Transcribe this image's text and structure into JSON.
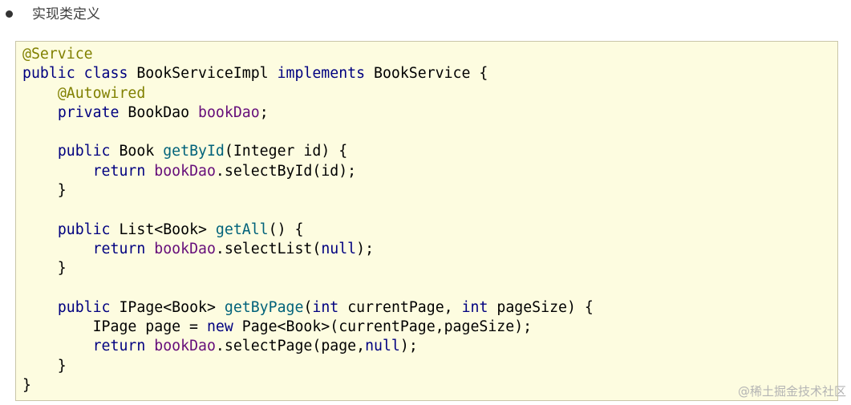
{
  "bullet": {
    "text": "实现类定义"
  },
  "code_block": {
    "language": "java",
    "lines": [
      [
        {
          "t": "@Service",
          "k": "anno"
        }
      ],
      [
        {
          "t": "public",
          "k": "kw"
        },
        {
          "t": " ",
          "k": "plain"
        },
        {
          "t": "class",
          "k": "kw"
        },
        {
          "t": " BookServiceImpl ",
          "k": "plain"
        },
        {
          "t": "implements",
          "k": "kw"
        },
        {
          "t": " BookService {",
          "k": "plain"
        }
      ],
      [
        {
          "t": "    ",
          "k": "plain"
        },
        {
          "t": "@Autowired",
          "k": "anno"
        }
      ],
      [
        {
          "t": "    ",
          "k": "plain"
        },
        {
          "t": "private",
          "k": "kw"
        },
        {
          "t": " BookDao ",
          "k": "plain"
        },
        {
          "t": "bookDao",
          "k": "field"
        },
        {
          "t": ";",
          "k": "plain"
        }
      ],
      [],
      [
        {
          "t": "    ",
          "k": "plain"
        },
        {
          "t": "public",
          "k": "kw"
        },
        {
          "t": " Book ",
          "k": "plain"
        },
        {
          "t": "getById",
          "k": "method"
        },
        {
          "t": "(Integer id) {",
          "k": "plain"
        }
      ],
      [
        {
          "t": "        ",
          "k": "plain"
        },
        {
          "t": "return",
          "k": "kw"
        },
        {
          "t": " ",
          "k": "plain"
        },
        {
          "t": "bookDao",
          "k": "field"
        },
        {
          "t": ".selectById(id);",
          "k": "plain"
        }
      ],
      [
        {
          "t": "    }",
          "k": "plain"
        }
      ],
      [],
      [
        {
          "t": "    ",
          "k": "plain"
        },
        {
          "t": "public",
          "k": "kw"
        },
        {
          "t": " List<Book> ",
          "k": "plain"
        },
        {
          "t": "getAll",
          "k": "method"
        },
        {
          "t": "() {",
          "k": "plain"
        }
      ],
      [
        {
          "t": "        ",
          "k": "plain"
        },
        {
          "t": "return",
          "k": "kw"
        },
        {
          "t": " ",
          "k": "plain"
        },
        {
          "t": "bookDao",
          "k": "field"
        },
        {
          "t": ".selectList(",
          "k": "plain"
        },
        {
          "t": "null",
          "k": "kw"
        },
        {
          "t": ");",
          "k": "plain"
        }
      ],
      [
        {
          "t": "    }",
          "k": "plain"
        }
      ],
      [],
      [
        {
          "t": "    ",
          "k": "plain"
        },
        {
          "t": "public",
          "k": "kw"
        },
        {
          "t": " IPage<Book> ",
          "k": "plain"
        },
        {
          "t": "getByPage",
          "k": "method"
        },
        {
          "t": "(",
          "k": "plain"
        },
        {
          "t": "int",
          "k": "kw"
        },
        {
          "t": " currentPage, ",
          "k": "plain"
        },
        {
          "t": "int",
          "k": "kw"
        },
        {
          "t": " pageSize) {",
          "k": "plain"
        }
      ],
      [
        {
          "t": "        IPage page = ",
          "k": "plain"
        },
        {
          "t": "new",
          "k": "kw"
        },
        {
          "t": " Page<Book>(currentPage,pageSize);",
          "k": "plain"
        }
      ],
      [
        {
          "t": "        ",
          "k": "plain"
        },
        {
          "t": "return",
          "k": "kw"
        },
        {
          "t": " ",
          "k": "plain"
        },
        {
          "t": "bookDao",
          "k": "field"
        },
        {
          "t": ".selectPage(page,",
          "k": "plain"
        },
        {
          "t": "null",
          "k": "kw"
        },
        {
          "t": ");",
          "k": "plain"
        }
      ],
      [
        {
          "t": "    }",
          "k": "plain"
        }
      ],
      [
        {
          "t": "}",
          "k": "plain"
        }
      ]
    ]
  },
  "watermark": {
    "text": "@稀土掘金技术社区"
  },
  "colors": {
    "keyword": "#000080",
    "annotation": "#808000",
    "field": "#660e7a",
    "method": "#00627a",
    "code_background": "#fdfce0",
    "code_border": "#c9c6a8"
  }
}
